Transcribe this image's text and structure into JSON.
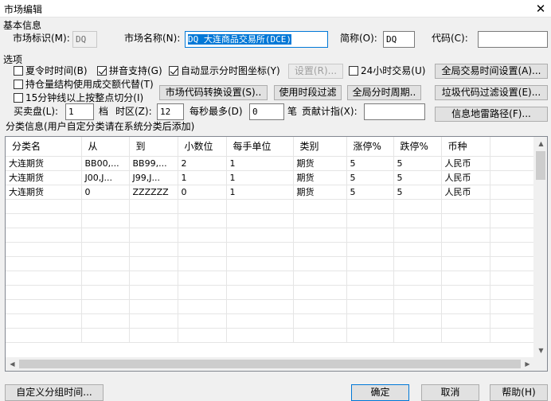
{
  "window": {
    "title": "市场编辑",
    "close_glyph": "✕"
  },
  "basic": {
    "group_label": "基本信息",
    "market_id_label": "市场标识(M):",
    "market_id_value": "DQ",
    "market_name_label": "市场名称(N):",
    "market_name_value": "DQ 大连商品交易所(DCE)",
    "short_name_label": "简称(O):",
    "short_name_value": "DQ",
    "code_label": "代码(C):",
    "code_value": ""
  },
  "options": {
    "group_label": "选项",
    "checkboxes": [
      {
        "label": "夏令时时间(B)",
        "checked": false
      },
      {
        "label": "拼音支持(G)",
        "checked": true
      },
      {
        "label": "自动显示分时图坐标(Y)",
        "checked": true
      },
      {
        "label": "24小时交易(U)",
        "checked": false
      },
      {
        "label": "持仓量结构使用成交额代替(T)",
        "checked": false
      },
      {
        "label": "15分钟线以上按整点切分(I)",
        "checked": false
      }
    ],
    "settings_button": "设置(R)...",
    "global_trade_time_button": "全局交易时间设置(A)...",
    "market_code_convert_button": "市场代码转换设置(S)..",
    "use_period_filter_button": "使用时段过滤",
    "global_period_button": "全局分时周期..",
    "garbage_code_filter_button": "垃圾代码过滤设置(E)...",
    "info_mine_path_button": "信息地雷路径(F)...",
    "bid_ask_label": "买卖盘(L):",
    "bid_ask_value": "1",
    "bid_ask_unit": "档",
    "timezone_label": "时区(Z):",
    "timezone_value": "12",
    "max_per_sec_label": "每秒最多(D)",
    "max_per_sec_value": "0",
    "max_per_sec_unit": "笔",
    "contribution_label": "贡献计指(X):",
    "contribution_value": ""
  },
  "category": {
    "group_label": "分类信息(用户自定分类请在系统分类后添加)",
    "columns": [
      "分类名",
      "从",
      "到",
      "小数位",
      "每手单位",
      "类别",
      "涨停%",
      "跌停%",
      "币种",
      ""
    ],
    "rows": [
      [
        "大连期货",
        "BB00,...",
        "BB99,...",
        "2",
        "1",
        "期货",
        "5",
        "5",
        "人民币",
        ""
      ],
      [
        "大连期货",
        "J00,J...",
        "J99,J...",
        "1",
        "1",
        "期货",
        "5",
        "5",
        "人民币",
        ""
      ],
      [
        "大连期货",
        "0",
        "ZZZZZZ",
        "0",
        "1",
        "期货",
        "5",
        "5",
        "人民币",
        ""
      ]
    ]
  },
  "footer": {
    "custom_group_time_button": "自定义分组时间...",
    "ok_button": "确定",
    "cancel_button": "取消",
    "help_button": "帮助(H)"
  }
}
